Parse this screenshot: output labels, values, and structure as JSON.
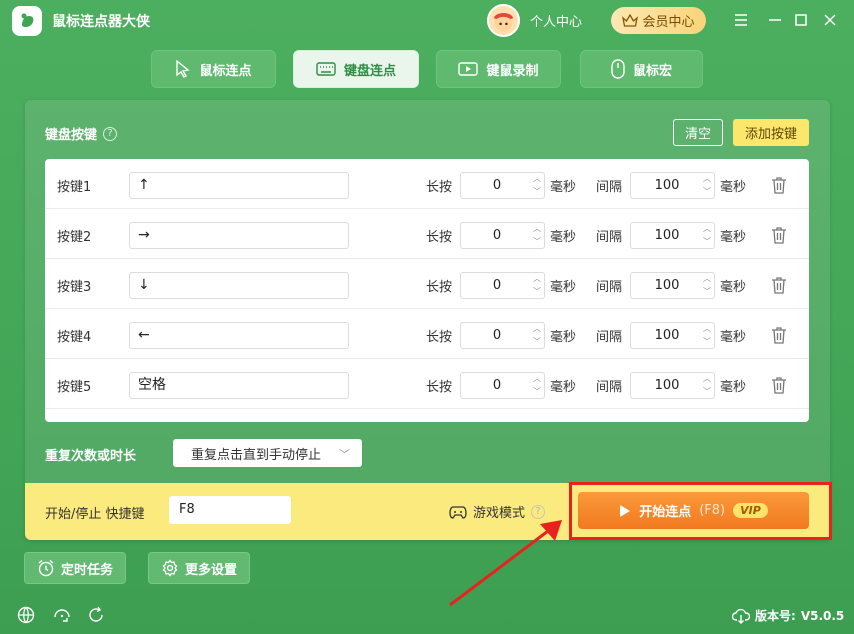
{
  "app": {
    "title": "鼠标连点器大侠"
  },
  "header": {
    "personal_center": "个人中心",
    "vip_center": "会员中心"
  },
  "tabs": [
    {
      "label": "鼠标连点",
      "icon": "cursor-icon"
    },
    {
      "label": "键盘连点",
      "icon": "keyboard-icon",
      "active": true
    },
    {
      "label": "键鼠录制",
      "icon": "record-icon"
    },
    {
      "label": "鼠标宏",
      "icon": "mouse-icon"
    }
  ],
  "panel": {
    "title": "键盘按键",
    "help": "?",
    "clear_label": "清空",
    "add_label": "添加按键",
    "hold_label": "长按",
    "interval_label": "间隔",
    "unit_label": "毫秒",
    "rows": [
      {
        "name": "按键1",
        "key": "↑",
        "hold": "0",
        "interval": "100"
      },
      {
        "name": "按键2",
        "key": "→",
        "hold": "0",
        "interval": "100"
      },
      {
        "name": "按键3",
        "key": "↓",
        "hold": "0",
        "interval": "100"
      },
      {
        "name": "按键4",
        "key": "←",
        "hold": "0",
        "interval": "100"
      },
      {
        "name": "按键5",
        "key": "空格",
        "hold": "0",
        "interval": "100"
      }
    ],
    "repeat_label": "重复次数或时长",
    "repeat_value": "重复点击直到手动停止"
  },
  "footer": {
    "hotkey_label": "开始/停止 快捷键",
    "hotkey_value": "F8",
    "game_mode_label": "游戏模式",
    "start_label": "开始连点",
    "start_hotkey": "(F8)",
    "vip_tag": "VIP"
  },
  "bottom": {
    "timer_label": "定时任务",
    "settings_label": "更多设置",
    "version_label": "版本号:",
    "version_value": "V5.0.5"
  },
  "colors": {
    "accent_green": "#4caf5f",
    "highlight_red": "#e8231d",
    "start_orange": "#f27920",
    "footer_yellow": "#fbeb7e"
  }
}
